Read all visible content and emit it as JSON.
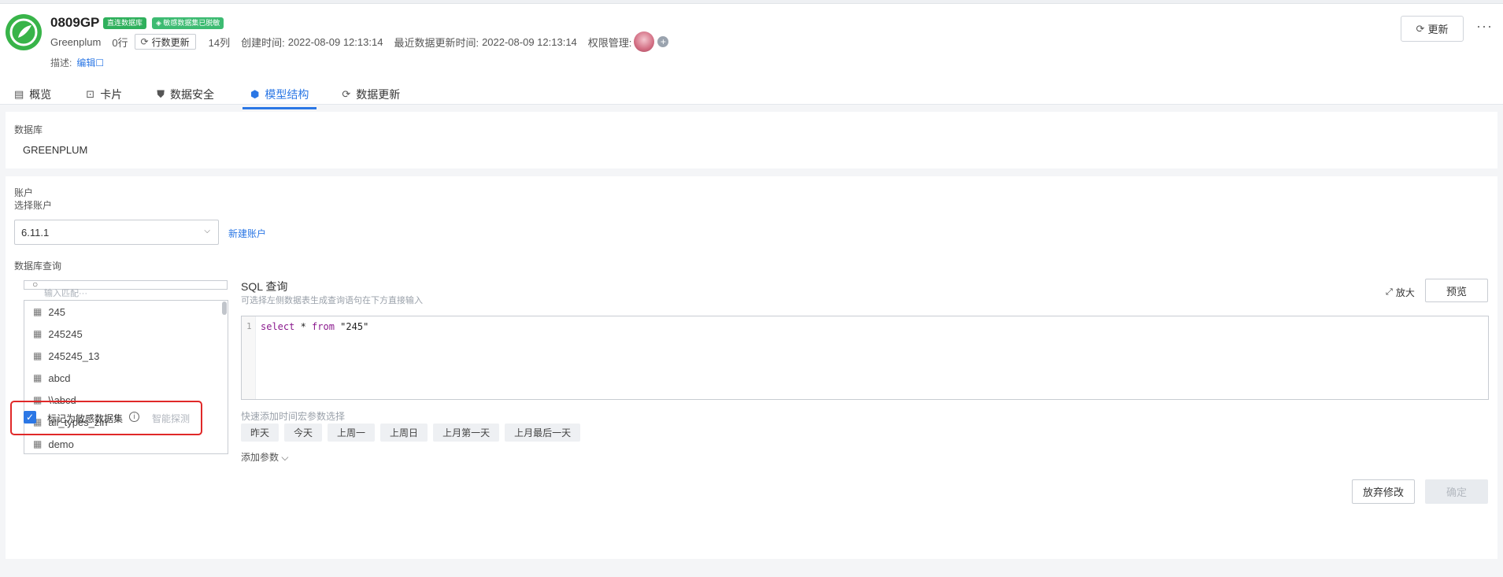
{
  "dataset": {
    "name": "0809GP",
    "badge_direct": "直连数据库",
    "badge_sensitive": "敏感数据集已脱敏",
    "db_type": "Greenplum",
    "rows": "0行",
    "row_update": "行数更新",
    "cols": "14列",
    "created_label": "创建时间:",
    "created_value": "2022-08-09 12:13:14",
    "updated_label": "最近数据更新时间:",
    "updated_value": "2022-08-09 12:13:14",
    "permission_label": "权限管理:",
    "desc_label": "描述:",
    "edit_label": "编辑"
  },
  "header_actions": {
    "update": "更新",
    "more": "···"
  },
  "tabs": [
    {
      "label": "概览",
      "icon": "document-icon"
    },
    {
      "label": "卡片",
      "icon": "chart-icon"
    },
    {
      "label": "数据安全",
      "icon": "shield-icon"
    },
    {
      "label": "模型结构",
      "icon": "cube-icon",
      "active": true
    },
    {
      "label": "数据更新",
      "icon": "refresh-icon"
    }
  ],
  "database": {
    "label": "数据库",
    "value": "GREENPLUM"
  },
  "account": {
    "section_label": "账户",
    "select_label": "选择账户",
    "selected": "6.11.1",
    "new_account": "新建账户"
  },
  "query": {
    "section_label": "数据库查询",
    "search_placeholder": "输入匹配···",
    "tables": [
      "245",
      "245245",
      "245245_13",
      "abcd",
      "\\\\abcd",
      "all_types_zln",
      "demo"
    ],
    "mark_sensitive": "标记为敏感数据集",
    "mark_sensitive_checked": true,
    "smart_detect": "智能探测"
  },
  "sql": {
    "title": "SQL 查询",
    "subtitle": "可选择左侧数据表生成查询语句在下方直接输入",
    "expand": "放大",
    "preview": "预览",
    "line_no": "1",
    "code_kw1": "select",
    "code_mid": " * ",
    "code_kw2": "from",
    "code_str": " \"245\"",
    "quick_label": "快速添加时间宏参数选择",
    "quick_chips": [
      "昨天",
      "今天",
      "上周一",
      "上周日",
      "上月第一天",
      "上月最后一天"
    ],
    "add_param": "添加参数 ⌵"
  },
  "footer": {
    "discard": "放弃修改",
    "confirm": "确定"
  },
  "colors": {
    "accent": "#2b77e5",
    "brand": "#38b449",
    "highlight": "#e02828"
  }
}
